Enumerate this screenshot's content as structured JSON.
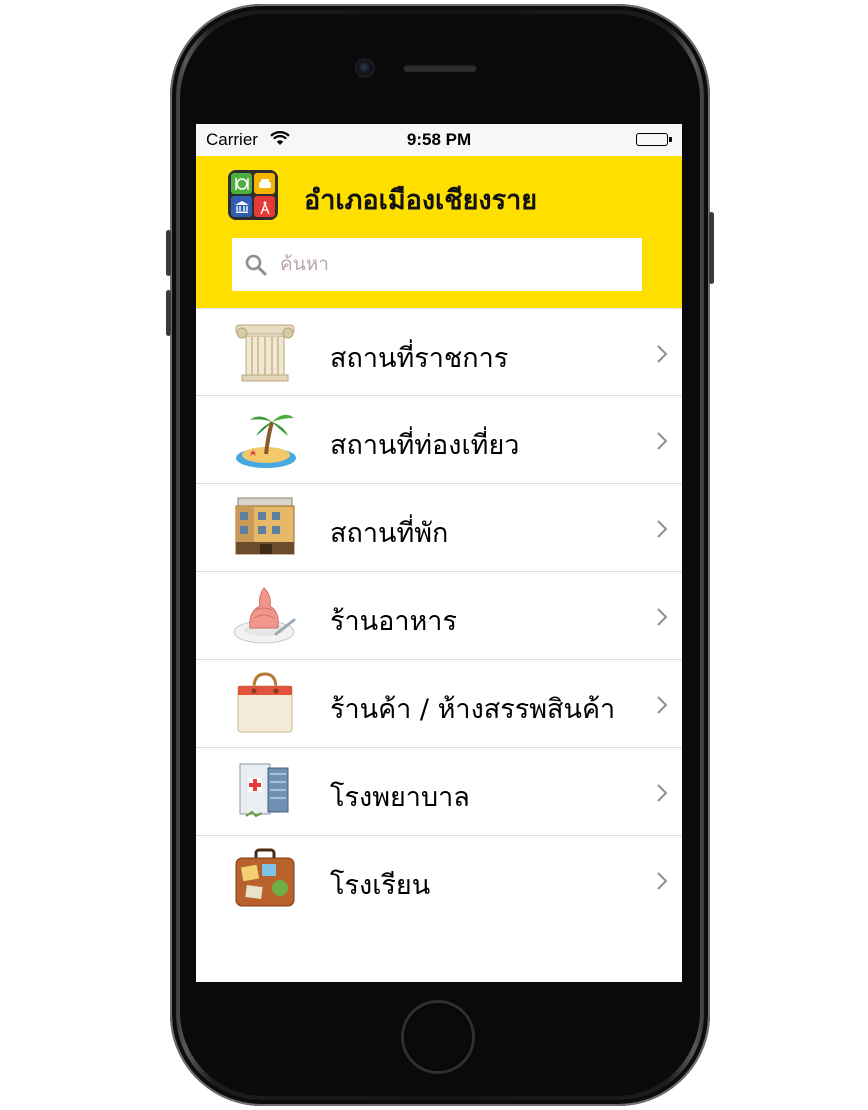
{
  "status_bar": {
    "carrier": "Carrier",
    "time": "9:58 PM"
  },
  "header": {
    "title": "อำเภอเมืองเชียงราย",
    "background_color": "#fedf00"
  },
  "search": {
    "placeholder": "ค้นหา",
    "value": ""
  },
  "menu": {
    "items": [
      {
        "label": "สถานที่ราชการ",
        "icon": "government-column-icon"
      },
      {
        "label": "สถานที่ท่องเที่ยว",
        "icon": "palm-island-icon"
      },
      {
        "label": "สถานที่พัก",
        "icon": "hotel-building-icon"
      },
      {
        "label": "ร้านอาหาร",
        "icon": "ice-cream-dish-icon"
      },
      {
        "label": "ร้านค้า / ห้างสรรพสินค้า",
        "icon": "shopping-bag-icon"
      },
      {
        "label": "โรงพยาบาล",
        "icon": "hospital-building-icon"
      },
      {
        "label": "โรงเรียน",
        "icon": "suitcase-icon"
      }
    ]
  },
  "colors": {
    "header_yellow": "#fedf00",
    "separator": "#dedede",
    "chevron": "#c7c7cc"
  }
}
